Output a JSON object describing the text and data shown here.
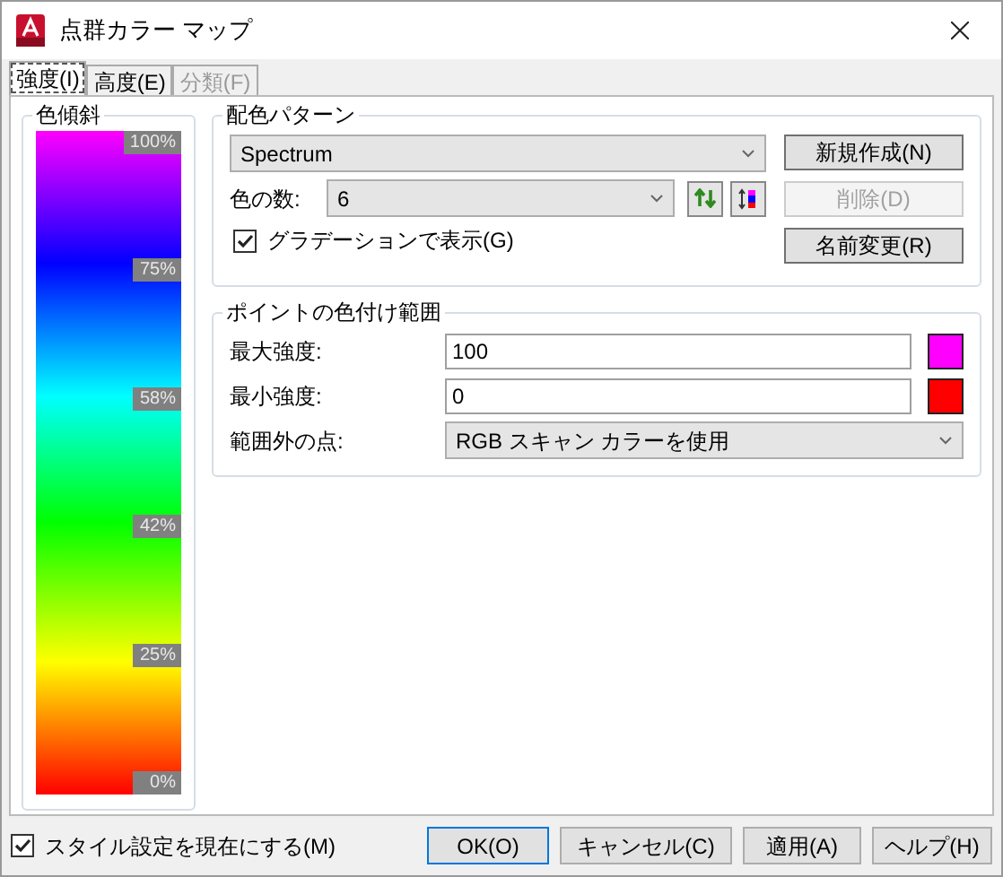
{
  "window": {
    "title": "点群カラー マップ"
  },
  "tabs": [
    {
      "label": "強度(I)",
      "selected": true,
      "disabled": false
    },
    {
      "label": "高度(E)",
      "selected": false,
      "disabled": false
    },
    {
      "label": "分類(F)",
      "selected": false,
      "disabled": true
    }
  ],
  "gradient": {
    "title": "色傾斜",
    "marks": [
      "100%",
      "75%",
      "58%",
      "42%",
      "25%",
      "0%"
    ]
  },
  "color_scheme": {
    "title": "配色パターン",
    "scheme": "Spectrum",
    "count_label": "色の数:",
    "count": "6",
    "show_gradient": {
      "label": "グラデーションで表示(G)",
      "checked": true
    },
    "buttons": [
      {
        "label": "新規作成(N)",
        "disabled": false
      },
      {
        "label": "削除(D)",
        "disabled": true
      },
      {
        "label": "名前変更(R)",
        "disabled": false
      }
    ]
  },
  "range": {
    "title": "ポイントの色付け範囲",
    "rows": [
      {
        "kind": "input",
        "label": "最大強度:",
        "value": "100",
        "color": "#ff00ff"
      },
      {
        "kind": "input",
        "label": "最小強度:",
        "value": "0",
        "color": "#ff0000"
      },
      {
        "kind": "dropdown",
        "label": "範囲外の点:",
        "value": "RGB スキャン カラーを使用"
      }
    ]
  },
  "footer": {
    "make_current": {
      "label": "スタイル設定を現在にする(M)",
      "checked": true
    },
    "buttons": [
      {
        "label": "OK(O)",
        "default": true
      },
      {
        "label": "キャンセル(C)",
        "default": false
      },
      {
        "label": "適用(A)",
        "default": false
      },
      {
        "label": "ヘルプ(H)",
        "default": false
      }
    ]
  }
}
